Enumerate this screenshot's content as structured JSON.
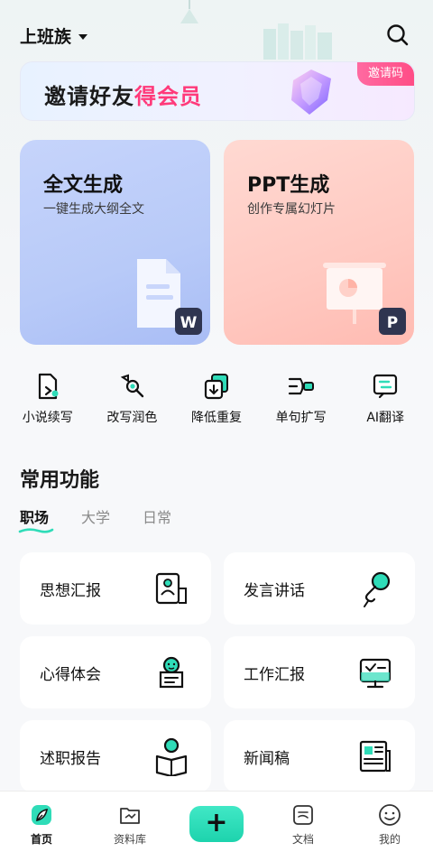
{
  "header": {
    "identity": "上班族"
  },
  "banner": {
    "text_main": "邀请好友",
    "text_highlight": "得会员",
    "badge": "邀请码"
  },
  "cards": [
    {
      "title": "全文生成",
      "subtitle": "一键生成大纲全文",
      "badge_letter": "W"
    },
    {
      "title": "PPT生成",
      "subtitle": "创作专属幻灯片",
      "badge_letter": "P"
    }
  ],
  "quick_actions": [
    {
      "label": "小说续写",
      "icon": "novel-continue-icon"
    },
    {
      "label": "改写润色",
      "icon": "polish-icon"
    },
    {
      "label": "降低重复",
      "icon": "reduce-duplicate-icon"
    },
    {
      "label": "单句扩写",
      "icon": "expand-sentence-icon"
    },
    {
      "label": "AI翻译",
      "icon": "translate-icon"
    }
  ],
  "common": {
    "title": "常用功能",
    "tabs": [
      "职场",
      "大学",
      "日常"
    ],
    "active_tab": 0,
    "items": [
      {
        "label": "思想汇报",
        "icon": "thought-report-icon"
      },
      {
        "label": "发言讲话",
        "icon": "microphone-icon"
      },
      {
        "label": "心得体会",
        "icon": "insight-icon"
      },
      {
        "label": "工作汇报",
        "icon": "work-report-icon"
      },
      {
        "label": "述职报告",
        "icon": "reading-person-icon"
      },
      {
        "label": "新闻稿",
        "icon": "newspaper-icon"
      }
    ]
  },
  "bottom_nav": {
    "items": [
      "首页",
      "资料库",
      "文档",
      "我的"
    ],
    "add_symbol": "+"
  },
  "colors": {
    "accent": "#2fdcb8",
    "highlight": "#ff3a7a"
  }
}
